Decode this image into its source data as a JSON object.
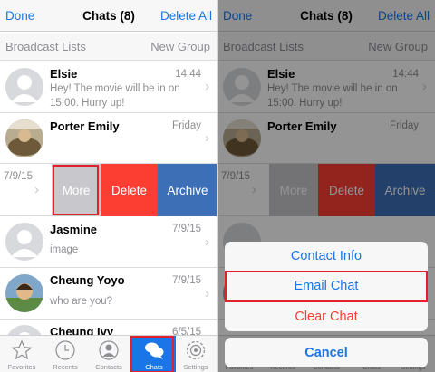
{
  "nav": {
    "left": "Done",
    "title": "Chats (8)",
    "right": "Delete All"
  },
  "subbar": {
    "left": "Broadcast Lists",
    "right": "New Group"
  },
  "chats": [
    {
      "name": "Elsie",
      "time": "14:44",
      "preview": "Hey! The movie will be in on 15:00. Hurry up!"
    },
    {
      "name": "Porter Emily",
      "time": "Friday",
      "preview": ""
    },
    {
      "name": "",
      "time": "7/9/15",
      "preview": ""
    },
    {
      "name": "Jasmine",
      "time": "7/9/15",
      "preview": "image"
    },
    {
      "name": "Cheung Yoyo",
      "time": "7/9/15",
      "preview": "who are you?"
    },
    {
      "name": "Cheung Ivy",
      "time": "6/5/15",
      "preview": ""
    }
  ],
  "swipe_actions": {
    "more": "More",
    "delete": "Delete",
    "archive": "Archive"
  },
  "tabs": [
    {
      "label": "Favorites",
      "icon": "star-icon"
    },
    {
      "label": "Recents",
      "icon": "clock-icon"
    },
    {
      "label": "Contacts",
      "icon": "contact-icon"
    },
    {
      "label": "Chats",
      "icon": "chat-bubbles-icon",
      "active": true
    },
    {
      "label": "Settings",
      "icon": "gear-icon"
    }
  ],
  "action_sheet": {
    "contact_info": "Contact Info",
    "email_chat": "Email Chat",
    "clear_chat": "Clear Chat",
    "cancel": "Cancel"
  },
  "colors": {
    "accent": "#1a76e6",
    "highlight": "#e0202b",
    "delete": "#fb3d32",
    "archive": "#3c6fb6",
    "more": "#c7c7cc"
  }
}
